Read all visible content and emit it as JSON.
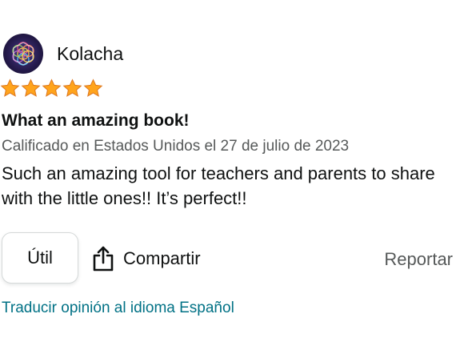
{
  "review": {
    "author": "Kolacha",
    "rating": 5,
    "rating_max": 5,
    "title": "What an amazing book!",
    "meta": "Calificado en Estados Unidos el 27 de julio de 2023",
    "body": "Such an amazing tool for teachers and parents to share with the little ones!! It’s perfect!!"
  },
  "actions": {
    "helpful_label": "Útil",
    "share_label": "Compartir",
    "report_label": "Reportar",
    "translate_label": "Traducir opinión al idioma Español"
  },
  "icons": {
    "avatar": "sacred-geometry-avatar",
    "star": "star-icon",
    "share": "share-icon"
  },
  "colors": {
    "star": "#ffa41c",
    "star_outline": "#de7921",
    "link": "#007185",
    "muted": "#565959",
    "text": "#0f1111"
  }
}
